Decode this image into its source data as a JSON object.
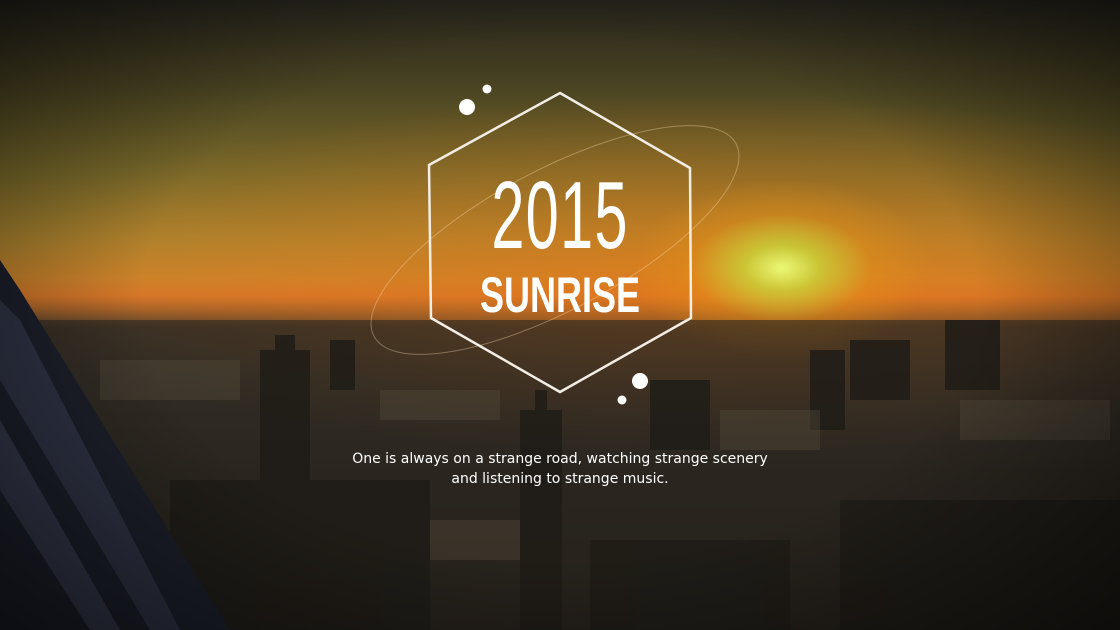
{
  "slide": {
    "year": "2015",
    "title": "SUNRISE",
    "quote": "One is always on a strange road, watching strange scenery and listening to strange music."
  },
  "colors": {
    "text": "#ffffff",
    "sun": "#e8ff78",
    "sky": "#c8832c"
  }
}
